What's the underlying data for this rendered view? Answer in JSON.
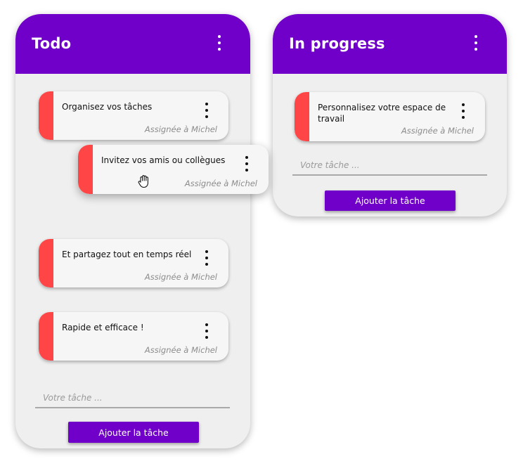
{
  "columns": {
    "todo": {
      "title": "Todo",
      "cards": [
        {
          "text": "Organisez vos tâches",
          "assignee": "Assignée à Michel"
        },
        {
          "text": "Invitez vos amis ou collègues",
          "assignee": "Assignée à Michel"
        },
        {
          "text": "Et partagez tout en temps réel",
          "assignee": "Assignée à Michel"
        },
        {
          "text": "Rapide et efficace !",
          "assignee": "Assignée à Michel"
        }
      ],
      "input_placeholder": "Votre tâche ...",
      "add_button_label": "Ajouter la tâche"
    },
    "in_progress": {
      "title": "In progress",
      "cards": [
        {
          "text": "Personnalisez votre espace de travail",
          "assignee": "Assignée à Michel"
        }
      ],
      "input_placeholder": "Votre tâche ...",
      "add_button_label": "Ajouter la tâche"
    }
  },
  "icons": {
    "column_menu": "kebab-menu-icon",
    "card_menu": "kebab-menu-icon",
    "cursor": "grab-hand-icon"
  },
  "colors": {
    "header": "#7000c9",
    "button": "#7000c9",
    "card_stripe": "#ff4545",
    "column_bg": "#efefef",
    "card_bg": "#f6f6f6"
  }
}
